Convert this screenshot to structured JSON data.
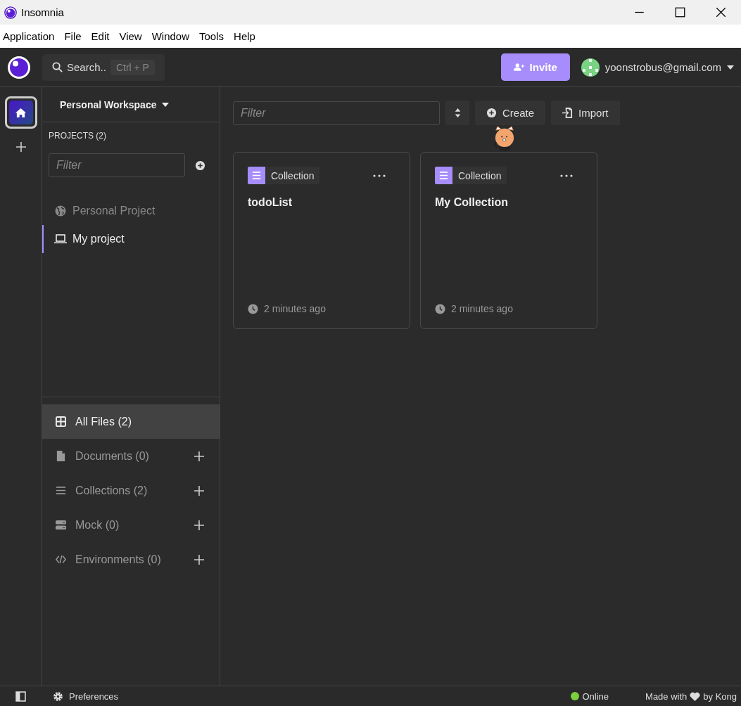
{
  "window": {
    "title": "Insomnia"
  },
  "menu": [
    "Application",
    "File",
    "Edit",
    "View",
    "Window",
    "Tools",
    "Help"
  ],
  "header": {
    "search": {
      "label": "Search..",
      "shortcut": "Ctrl + P"
    },
    "invite": "Invite",
    "account": "yoonstrobus@gmail.com"
  },
  "rail": [
    {
      "kind": "home",
      "selected": true
    },
    {
      "kind": "add",
      "selected": false
    }
  ],
  "sidebar": {
    "workspace": "Personal Workspace",
    "projects_heading": "PROJECTS (2)",
    "filter": {
      "placeholder": "Filter"
    },
    "projects": [
      {
        "kind": "remote",
        "name": "Personal Project",
        "selected": false
      },
      {
        "kind": "local",
        "name": "My project",
        "selected": true
      }
    ],
    "nav": [
      {
        "kind": "all",
        "label": "All Files (2)",
        "selected": true
      },
      {
        "kind": "documents",
        "label": "Documents (0)",
        "selected": false
      },
      {
        "kind": "collections",
        "label": "Collections (2)",
        "selected": false
      },
      {
        "kind": "mock",
        "label": "Mock (0)",
        "selected": false
      },
      {
        "kind": "environments",
        "label": "Environments (0)",
        "selected": false
      }
    ]
  },
  "main": {
    "filter": {
      "placeholder": "Filter"
    },
    "create": "Create",
    "import": "Import",
    "cards": [
      {
        "type": "Collection",
        "title": "todoList",
        "updated": "2 minutes ago"
      },
      {
        "type": "Collection",
        "title": "My Collection",
        "updated": "2 minutes ago"
      }
    ]
  },
  "status_bar": {
    "preferences": "Preferences",
    "status": "Online",
    "made_with": "Made with",
    "by": "by Kong"
  }
}
